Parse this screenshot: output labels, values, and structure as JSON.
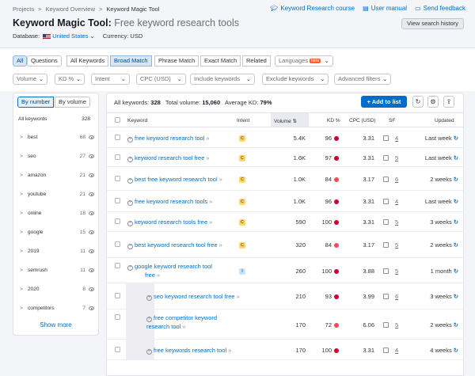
{
  "breadcrumbs": [
    "Projects",
    "Keyword Overview",
    "Keyword Magic Tool"
  ],
  "top_links": [
    {
      "label": "Keyword Research course",
      "icon": "graduation-cap-icon"
    },
    {
      "label": "User manual",
      "icon": "book-icon"
    },
    {
      "label": "Send feedback",
      "icon": "chat-icon"
    }
  ],
  "page_title": {
    "tool": "Keyword Magic Tool:",
    "seed": "Free keyword research tools"
  },
  "database": {
    "label": "Database:",
    "value": "United States",
    "currency": "Currency: USD"
  },
  "view_history": "View search history",
  "tabs_row": {
    "match_a": [
      "All",
      "Questions"
    ],
    "match_b": [
      "All Keywords",
      "Broad Match",
      "Phrase Match",
      "Exact Match",
      "Related"
    ],
    "languages": "Languages",
    "beta": "beta"
  },
  "filters": [
    "Volume",
    "KD %",
    "Intent",
    "CPC (USD)",
    "Include keywords",
    "Exclude keywords",
    "Advanced filters"
  ],
  "sidebar": {
    "toggle": [
      "By number",
      "By volume"
    ],
    "header": {
      "label": "All keywords",
      "count": "328"
    },
    "groups": [
      {
        "label": "best",
        "count": "68"
      },
      {
        "label": "seo",
        "count": "27"
      },
      {
        "label": "amazon",
        "count": "21"
      },
      {
        "label": "youtube",
        "count": "21"
      },
      {
        "label": "online",
        "count": "18"
      },
      {
        "label": "google",
        "count": "15"
      },
      {
        "label": "2019",
        "count": "11"
      },
      {
        "label": "semrush",
        "count": "11"
      },
      {
        "label": "2020",
        "count": "8"
      },
      {
        "label": "competitors",
        "count": "7"
      }
    ],
    "show_more": "Show more"
  },
  "summary": {
    "all_label": "All keywords:",
    "all_value": "328",
    "vol_label": "Total volume:",
    "vol_value": "15,060",
    "kd_label": "Average KD:",
    "kd_value": "79%"
  },
  "add_to_list": "+ Add to list",
  "columns": [
    "Keyword",
    "Intent",
    "Volume",
    "KD %",
    "CPC (USD)",
    "SF",
    "Updated"
  ],
  "rows": [
    {
      "kw1": "free keyword research tool",
      "kw2": "",
      "intent": "C",
      "volume": "5.4K",
      "kd": "96",
      "kd_color": "#d1002f",
      "cpc": "3.31",
      "sf": "4",
      "updated": "Last week"
    },
    {
      "kw1": "keyword research tool free",
      "kw2": "",
      "intent": "C",
      "volume": "1.6K",
      "kd": "97",
      "kd_color": "#d1002f",
      "cpc": "3.31",
      "sf": "5",
      "updated": "Last week"
    },
    {
      "kw1": "best free keyword research tool",
      "kw2": "",
      "intent": "C",
      "volume": "1.0K",
      "kd": "84",
      "kd_color": "#ff4953",
      "cpc": "3.17",
      "sf": "6",
      "updated": "2 weeks"
    },
    {
      "kw1": "free keyword research tools",
      "kw2": "",
      "intent": "C",
      "volume": "1.0K",
      "kd": "96",
      "kd_color": "#d1002f",
      "cpc": "3.31",
      "sf": "4",
      "updated": "Last week"
    },
    {
      "kw1": "keyword research tools free",
      "kw2": "",
      "intent": "C",
      "volume": "590",
      "kd": "100",
      "kd_color": "#d1002f",
      "cpc": "3.31",
      "sf": "5",
      "updated": "3 weeks"
    },
    {
      "kw1": "best keyword research tool free",
      "kw2": "",
      "intent": "C",
      "volume": "320",
      "kd": "84",
      "kd_color": "#ff4953",
      "cpc": "3.17",
      "sf": "5",
      "updated": "2 weeks"
    },
    {
      "kw1": "google keyword research tool",
      "kw2": "free",
      "intent": "I",
      "volume": "260",
      "kd": "100",
      "kd_color": "#d1002f",
      "cpc": "3.88",
      "sf": "5",
      "updated": "1 month"
    },
    {
      "kw1": "seo keyword research tool free",
      "kw2": "",
      "intent": "",
      "volume": "210",
      "kd": "93",
      "kd_color": "#d1002f",
      "cpc": "3.99",
      "sf": "6",
      "updated": "3 weeks"
    },
    {
      "kw1": "free competitor keyword",
      "kw2": "research tool",
      "intent": "",
      "volume": "170",
      "kd": "72",
      "kd_color": "#ff4953",
      "cpc": "6.06",
      "sf": "5",
      "updated": "2 weeks"
    },
    {
      "kw1": "free keywords research tool",
      "kw2": "",
      "intent": "",
      "volume": "170",
      "kd": "100",
      "kd_color": "#d1002f",
      "cpc": "3.31",
      "sf": "4",
      "updated": "4 weeks"
    }
  ]
}
